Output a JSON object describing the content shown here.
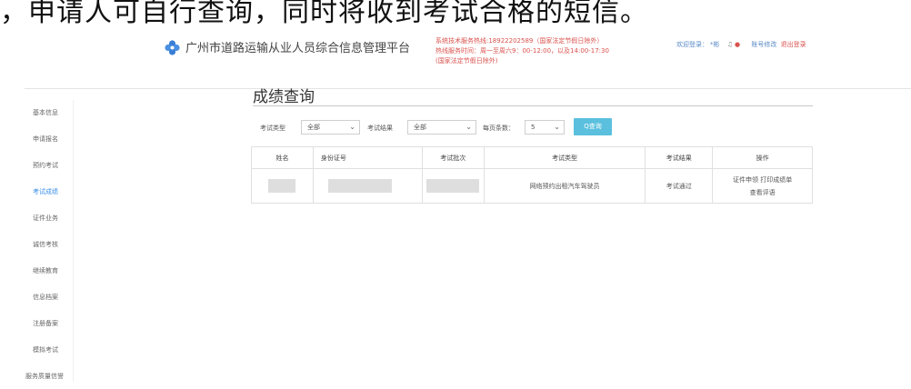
{
  "caption": "，申请人可自行查询，同时将收到考试合格的短信。",
  "header": {
    "logo_icon": "flower-logo-icon",
    "title": "广州市道路运输从业人员综合信息管理平台",
    "hotline_line1": "系统技术服务热线:18922202589（国家法定节假日除外）",
    "hotline_line2": "热线服务时间：周一至周六9：00-12:00，以及14:00-17:30",
    "hotline_line3": "(国家法定节假日除外)",
    "welcome": "欢迎登录：",
    "username": "*彬",
    "account_settings": "账号修改",
    "logout": "退出登录"
  },
  "sidebar": {
    "items": [
      {
        "label": "基本信息"
      },
      {
        "label": "申请报名"
      },
      {
        "label": "预约考试"
      },
      {
        "label": "考试成绩"
      },
      {
        "label": "证件业务"
      },
      {
        "label": "诚信考核"
      },
      {
        "label": "继续教育"
      },
      {
        "label": "信息档案"
      },
      {
        "label": "注册备案"
      },
      {
        "label": "模拟考试"
      },
      {
        "label": "服务质量信誉"
      }
    ],
    "active_index": 3
  },
  "main": {
    "title": "成绩查询",
    "filters": {
      "exam_type_label": "考试类型",
      "exam_type_value": "全部",
      "exam_result_label": "考试结果",
      "exam_result_value": "全部",
      "page_size_label": "每页条数：",
      "page_size_value": "5",
      "search_label": "Q查询"
    },
    "table": {
      "headers": [
        "姓名",
        "身份证号",
        "考试批次",
        "考试类型",
        "考试结果",
        "操作"
      ],
      "rows": [
        {
          "name": "",
          "id_number": "",
          "batch": "",
          "exam_type": "网络预约出租汽车驾驶员",
          "result": "考试通过",
          "op1": "证件申领 打印成绩单",
          "op2": "查看评语"
        }
      ]
    }
  },
  "colors": {
    "accent": "#3a8ee6",
    "search_button": "#5bc0de",
    "hotline": "#d9534f"
  }
}
